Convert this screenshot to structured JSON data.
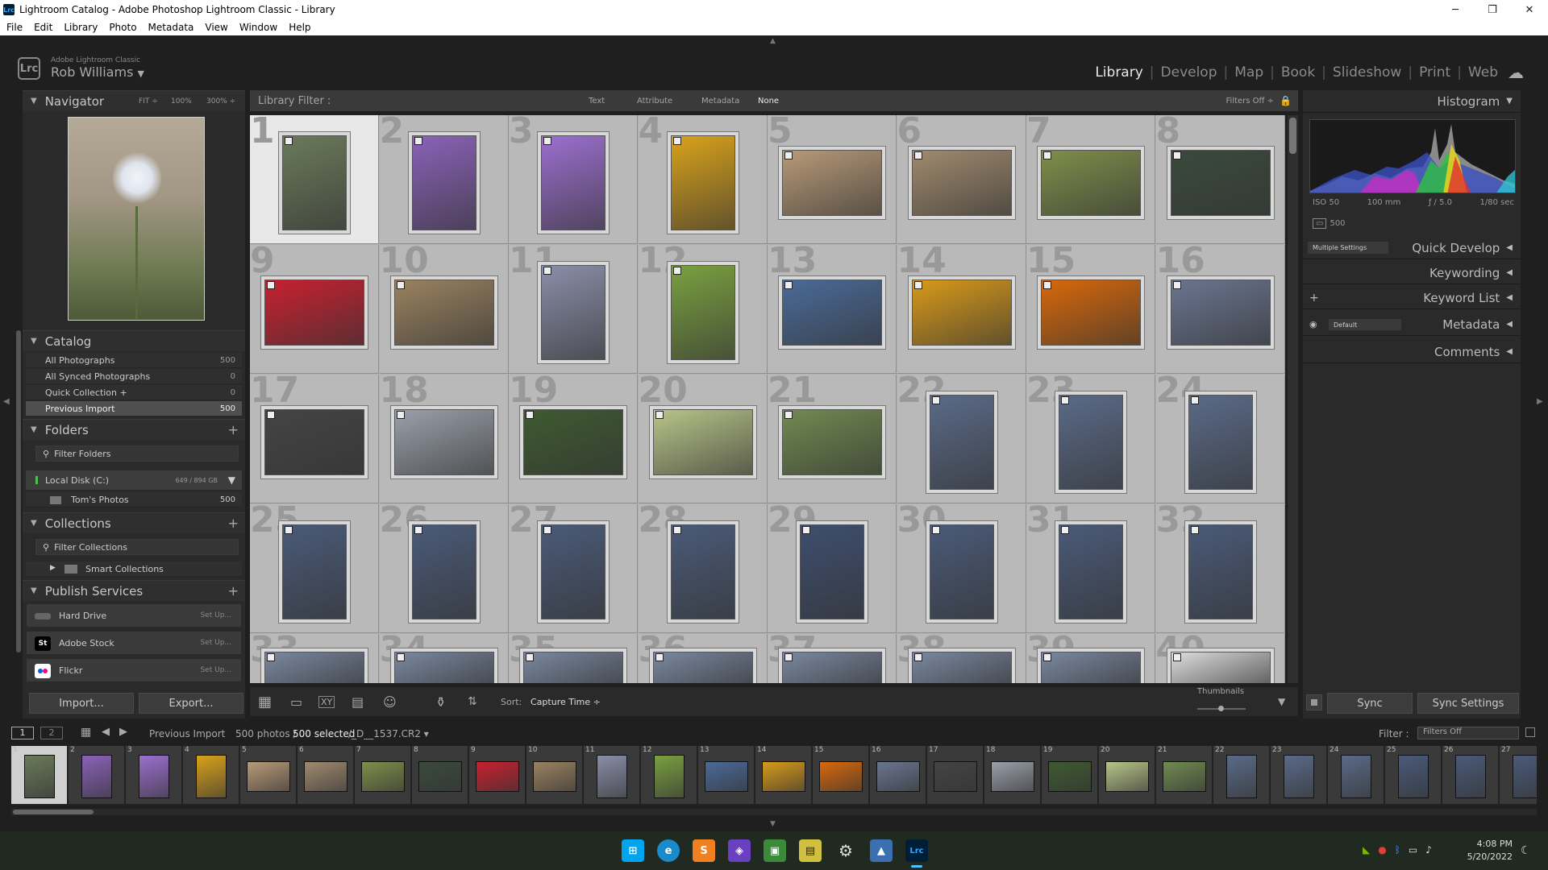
{
  "window": {
    "title": "Lightroom Catalog - Adobe Photoshop Lightroom Classic - Library",
    "app_icon": "Lrc"
  },
  "menu": [
    "File",
    "Edit",
    "Library",
    "Photo",
    "Metadata",
    "View",
    "Window",
    "Help"
  ],
  "identity": {
    "app_name": "Adobe Lightroom Classic",
    "user": "Rob Williams",
    "badge": "Lrc"
  },
  "modules": [
    "Library",
    "Develop",
    "Map",
    "Book",
    "Slideshow",
    "Print",
    "Web"
  ],
  "active_module": "Library",
  "navigator": {
    "title": "Navigator",
    "zoom": [
      "FIT ÷",
      "100%",
      "300% ÷"
    ]
  },
  "catalog": {
    "title": "Catalog",
    "items": [
      {
        "label": "All Photographs",
        "count": "500"
      },
      {
        "label": "All Synced Photographs",
        "count": "0"
      },
      {
        "label": "Quick Collection +",
        "count": "0"
      },
      {
        "label": "Previous Import",
        "count": "500"
      }
    ]
  },
  "folders": {
    "title": "Folders",
    "filter": "Filter Folders",
    "disk": "Local Disk (C:)",
    "disk_size": "649 / 894 GB",
    "folder": "Tom's Photos",
    "folder_count": "500"
  },
  "collections": {
    "title": "Collections",
    "filter": "Filter Collections",
    "smart": "Smart Collections"
  },
  "publish": {
    "title": "Publish Services",
    "items": [
      {
        "label": "Hard Drive",
        "setup": "Set Up...",
        "icon": "hard-drive-icon"
      },
      {
        "label": "Adobe Stock",
        "setup": "Set Up...",
        "icon": "St"
      },
      {
        "label": "Flickr",
        "setup": "Set Up...",
        "icon": "flickr-icon"
      }
    ]
  },
  "buttons": {
    "import": "Import...",
    "export": "Export...",
    "sync": "Sync",
    "sync_settings": "Sync Settings"
  },
  "library_filter": {
    "title": "Library Filter :",
    "tabs": [
      "Text",
      "Attribute",
      "Metadata",
      "None"
    ],
    "status": "Filters Off ÷"
  },
  "toolbar": {
    "sort_label": "Sort:",
    "sort_value": "Capture Time ÷",
    "thumbnails": "Thumbnails"
  },
  "histogram": {
    "title": "Histogram",
    "iso": "ISO 50",
    "focal": "100 mm",
    "aperture": "ƒ / 5.0",
    "shutter": "1/80 sec",
    "count": "500"
  },
  "right_panels": {
    "quick_develop": "Quick Develop",
    "multiple": "Multiple Settings",
    "keywording": "Keywording",
    "keyword_list": "Keyword List",
    "metadata": "Metadata",
    "default": "Default",
    "comments": "Comments"
  },
  "grid": {
    "cells": [
      {
        "n": "1",
        "c": "#6a7a5a"
      },
      {
        "n": "2",
        "c": "#8a62b8"
      },
      {
        "n": "3",
        "c": "#9c6fcf"
      },
      {
        "n": "4",
        "c": "#d9a21a"
      },
      {
        "n": "5",
        "c": "#b89a78"
      },
      {
        "n": "6",
        "c": "#a08a6e"
      },
      {
        "n": "7",
        "c": "#7e8f4a"
      },
      {
        "n": "8",
        "c": "#3a4a3c"
      },
      {
        "n": "9",
        "c": "#c82030"
      },
      {
        "n": "10",
        "c": "#9a8260"
      },
      {
        "n": "11",
        "c": "#8a8ea8"
      },
      {
        "n": "12",
        "c": "#7aa040"
      },
      {
        "n": "13",
        "c": "#4a6a98"
      },
      {
        "n": "14",
        "c": "#d89a1a"
      },
      {
        "n": "15",
        "c": "#d8680a"
      },
      {
        "n": "16",
        "c": "#6a7590"
      },
      {
        "n": "17",
        "c": "#444"
      },
      {
        "n": "18",
        "c": "#9aa0aa"
      },
      {
        "n": "19",
        "c": "#3e5a30"
      },
      {
        "n": "20",
        "c": "#b8c488"
      },
      {
        "n": "21",
        "c": "#708a50"
      },
      {
        "n": "22",
        "c": "#5a6a88"
      },
      {
        "n": "23",
        "c": "#5a6a88"
      },
      {
        "n": "24",
        "c": "#5a6a88"
      },
      {
        "n": "25",
        "c": "#4a5a78"
      },
      {
        "n": "26",
        "c": "#4a5a78"
      },
      {
        "n": "27",
        "c": "#4a5a78"
      },
      {
        "n": "28",
        "c": "#4a5a78"
      },
      {
        "n": "29",
        "c": "#3e4e6e"
      },
      {
        "n": "30",
        "c": "#4a5a78"
      },
      {
        "n": "31",
        "c": "#4a5a78"
      },
      {
        "n": "32",
        "c": "#4a5a78"
      },
      {
        "n": "33",
        "c": "#7a88a0"
      },
      {
        "n": "34",
        "c": "#7a88a0"
      },
      {
        "n": "35",
        "c": "#7a88a0"
      },
      {
        "n": "36",
        "c": "#7a88a0"
      },
      {
        "n": "37",
        "c": "#7a88a0"
      },
      {
        "n": "38",
        "c": "#7a88a0"
      },
      {
        "n": "39",
        "c": "#7a88a0"
      },
      {
        "n": "40",
        "c": "#ddd"
      }
    ]
  },
  "filmbar": {
    "source": "Previous Import",
    "photos": "500 photos /",
    "selected": "500 selected",
    "path": "/_D__1537.CR2 ▾",
    "filter_label": "Filter :",
    "filter_value": "Filters Off"
  },
  "filmstrip_count": 27,
  "clock": {
    "time": "4:08 PM",
    "date": "5/20/2022"
  }
}
